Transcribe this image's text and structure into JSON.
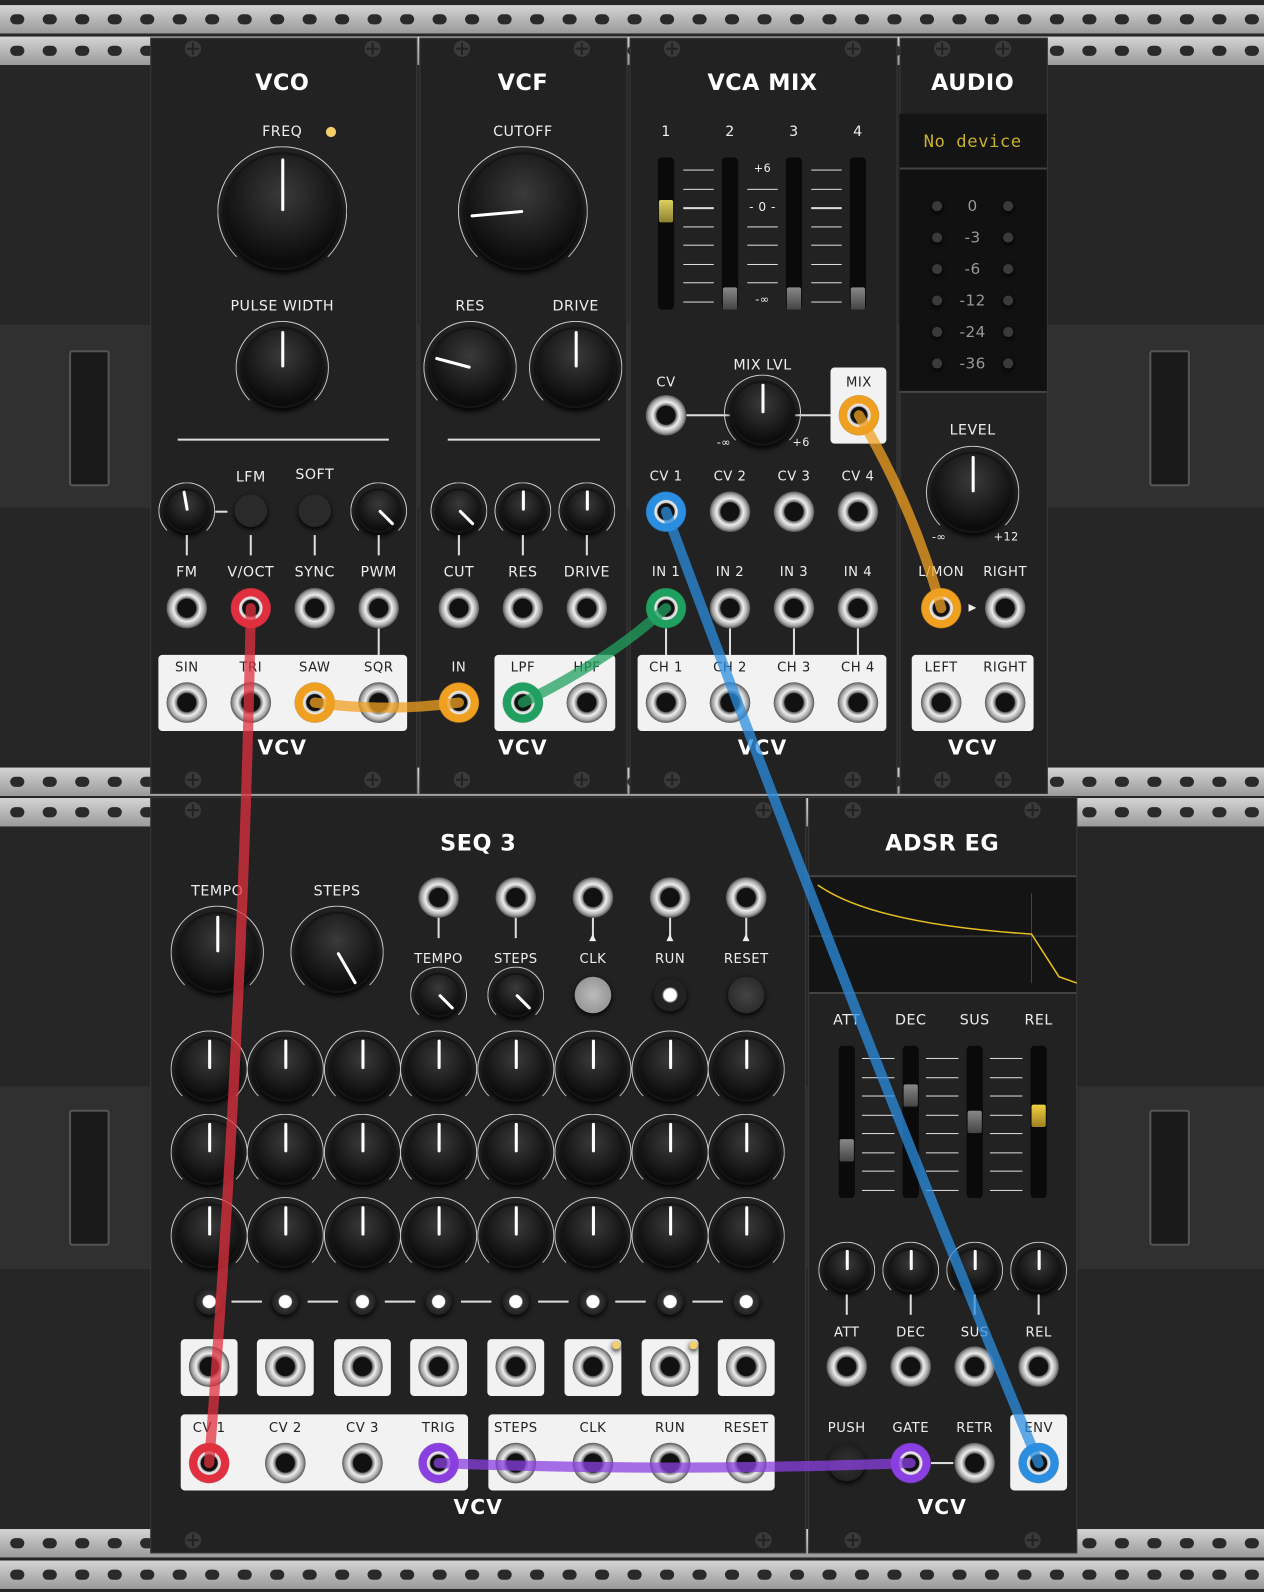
{
  "rack": {
    "brand": "VCV"
  },
  "vco": {
    "title": "VCO",
    "labels": [
      "FREQ",
      "PULSE WIDTH",
      "LFM",
      "SOFT",
      "FM",
      "V/OCT",
      "SYNC",
      "PWM",
      "SIN",
      "TRI",
      "SAW",
      "SQR"
    ]
  },
  "vcf": {
    "title": "VCF",
    "labels": [
      "CUTOFF",
      "RES",
      "DRIVE",
      "CUT",
      "RES",
      "DRIVE",
      "IN",
      "LPF",
      "HPF"
    ]
  },
  "vcamix": {
    "title": "VCA MIX",
    "labels": [
      "1",
      "2",
      "3",
      "4",
      "+6",
      "- 0 -",
      "-∞",
      "MIX LVL",
      "CV",
      "-∞",
      "+6",
      "MIX",
      "CV 1",
      "CV 2",
      "CV 3",
      "CV 4",
      "IN 1",
      "IN 2",
      "IN 3",
      "IN 4",
      "CH 1",
      "CH 2",
      "CH 3",
      "CH 4"
    ],
    "faders": [
      0.67,
      0,
      0,
      0
    ]
  },
  "audio": {
    "title": "AUDIO",
    "device": "No device",
    "meter": [
      "0",
      "-3",
      "-6",
      "-12",
      "-24",
      "-36"
    ],
    "labels": [
      "LEVEL",
      "-∞",
      "+12",
      "L/MON",
      "RIGHT",
      "LEFT",
      "RIGHT"
    ]
  },
  "seq3": {
    "title": "SEQ 3",
    "labels": [
      "TEMPO",
      "STEPS",
      "TEMPO",
      "STEPS",
      "CLK",
      "RUN",
      "RESET",
      "CV 1",
      "CV 2",
      "CV 3",
      "TRIG",
      "STEPS",
      "CLK",
      "RUN",
      "RESET"
    ]
  },
  "adsr": {
    "title": "ADSR EG",
    "labels": [
      "ATT",
      "DEC",
      "SUS",
      "REL",
      "ATT",
      "DEC",
      "SUS",
      "REL",
      "PUSH",
      "GATE",
      "RETR",
      "ENV"
    ],
    "faders": [
      0.28,
      0.7,
      0.5,
      0.55
    ]
  },
  "colors": {
    "red": "#e0303f",
    "orange": "#f0a020",
    "green": "#20a060",
    "blue": "#2b8ee0",
    "purple": "#8a3fe0",
    "led": "#f5d06a"
  }
}
